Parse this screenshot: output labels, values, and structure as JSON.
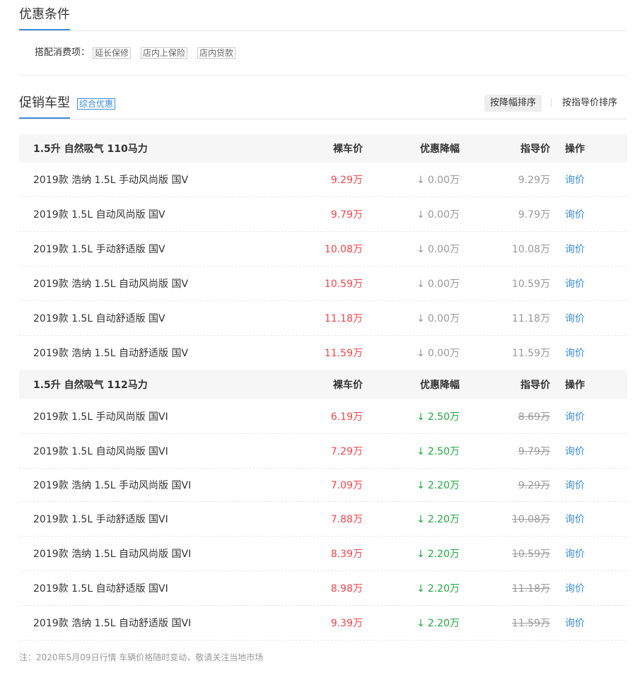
{
  "conditions": {
    "title": "优惠条件",
    "label": "搭配消费项：",
    "tags": [
      "延长保修",
      "店内上保险",
      "店内贷款"
    ]
  },
  "promo": {
    "title": "促销车型",
    "badge": "综合优惠",
    "sort_by_discount": "按降幅排序",
    "sort_by_guide": "按指导价排序"
  },
  "headers": {
    "price": "裸车价",
    "discount": "优惠降幅",
    "guide": "指导价",
    "action": "操作"
  },
  "groups": [
    {
      "name": "1.5升 自然吸气 110马力",
      "rows": [
        {
          "name": "2019款 浩纳 1.5L 手动风尚版 国V",
          "price": "9.29万",
          "discount": "0.00万",
          "guide": "9.29万",
          "action": "询价"
        },
        {
          "name": "2019款 1.5L 自动风尚版 国V",
          "price": "9.79万",
          "discount": "0.00万",
          "guide": "9.79万",
          "action": "询价"
        },
        {
          "name": "2019款 1.5L 手动舒适版 国V",
          "price": "10.08万",
          "discount": "0.00万",
          "guide": "10.08万",
          "action": "询价"
        },
        {
          "name": "2019款 浩纳 1.5L 自动风尚版 国V",
          "price": "10.59万",
          "discount": "0.00万",
          "guide": "10.59万",
          "action": "询价"
        },
        {
          "name": "2019款 1.5L 自动舒适版 国V",
          "price": "11.18万",
          "discount": "0.00万",
          "guide": "11.18万",
          "action": "询价"
        },
        {
          "name": "2019款 浩纳 1.5L 自动舒适版 国V",
          "price": "11.59万",
          "discount": "0.00万",
          "guide": "11.59万",
          "action": "询价"
        }
      ]
    },
    {
      "name": "1.5升 自然吸气 112马力",
      "rows": [
        {
          "name": "2019款 1.5L 手动风尚版 国VI",
          "price": "6.19万",
          "discount": "2.50万",
          "guide": "8.69万",
          "action": "询价"
        },
        {
          "name": "2019款 1.5L 自动风尚版 国VI",
          "price": "7.29万",
          "discount": "2.50万",
          "guide": "9.79万",
          "action": "询价"
        },
        {
          "name": "2019款 浩纳 1.5L 手动风尚版 国VI",
          "price": "7.09万",
          "discount": "2.20万",
          "guide": "9.29万",
          "action": "询价"
        },
        {
          "name": "2019款 1.5L 手动舒适版 国VI",
          "price": "7.88万",
          "discount": "2.20万",
          "guide": "10.08万",
          "action": "询价"
        },
        {
          "name": "2019款 浩纳 1.5L 自动风尚版 国VI",
          "price": "8.39万",
          "discount": "2.20万",
          "guide": "10.59万",
          "action": "询价"
        },
        {
          "name": "2019款 1.5L 自动舒适版 国VI",
          "price": "8.98万",
          "discount": "2.20万",
          "guide": "11.18万",
          "action": "询价"
        },
        {
          "name": "2019款 浩纳 1.5L 自动舒适版 国VI",
          "price": "9.39万",
          "discount": "2.20万",
          "guide": "11.59万",
          "action": "询价"
        }
      ]
    }
  ],
  "footer": "注：2020年5月09日行情 车辆价格随时变动，敬请关注当地市场",
  "colors": {
    "accent": "#3b8cd9",
    "price_red": "#f0464c",
    "discount_green": "#24a742"
  }
}
